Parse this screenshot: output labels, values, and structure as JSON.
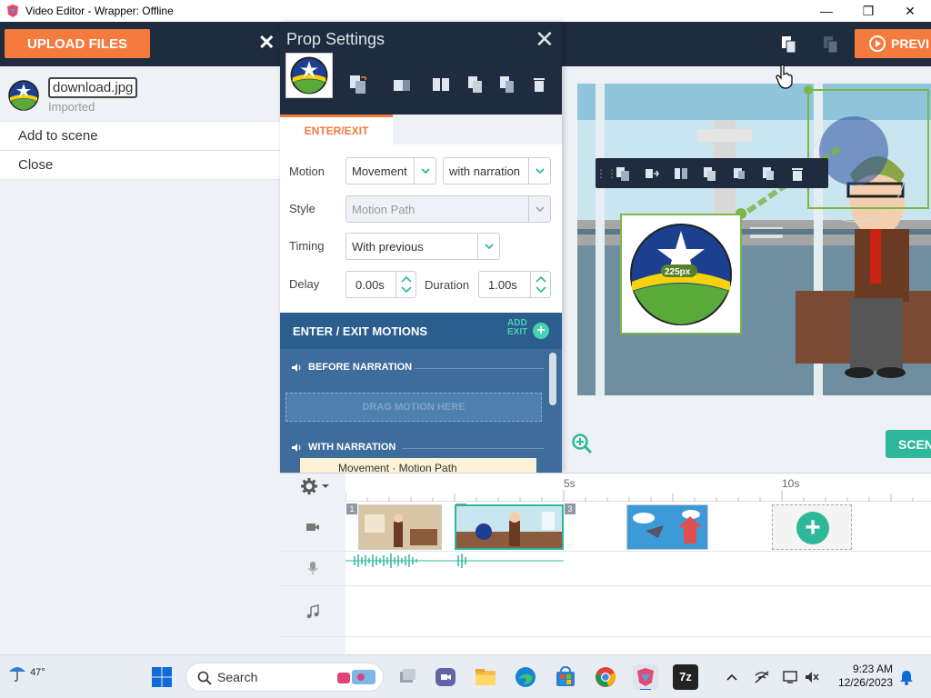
{
  "window": {
    "title": "Video Editor - Wrapper: Offline",
    "minimize": "—",
    "maximize": "❐",
    "close": "✕"
  },
  "header": {
    "upload_label": "UPLOAD FILES",
    "close_symbol": "✕",
    "preview_label": "PREVI"
  },
  "asset": {
    "name": "download.jpg",
    "status": "Imported"
  },
  "context_menu": [
    "Add to scene",
    "Close"
  ],
  "prop_settings": {
    "title": "Prop Settings",
    "close_symbol": "✕",
    "tab": "ENTER/EXIT",
    "motion_label": "Motion",
    "motion_value": "Movement",
    "narration_value": "with narration",
    "style_label": "Style",
    "style_value": "Motion Path",
    "timing_label": "Timing",
    "timing_value": "With previous",
    "delay_label": "Delay",
    "delay_value": "0.00s",
    "duration_label": "Duration",
    "duration_value": "1.00s",
    "motions_header": "ENTER / EXIT MOTIONS",
    "add_exit_line1": "ADD",
    "add_exit_line2": "EXIT",
    "before_narration": "BEFORE NARRATION",
    "drag_placeholder": "DRAG MOTION HERE",
    "with_narration": "WITH NARRATION",
    "motion_item": "Movement · Motion Path"
  },
  "stage": {
    "size_label": "225px",
    "scene_label": "SCENE"
  },
  "timeline": {
    "marker_5s": "5s",
    "marker_10s": "10s",
    "scene_numbers": [
      "1",
      "2",
      "3"
    ],
    "add_scene": "+"
  },
  "taskbar": {
    "temperature": "47°",
    "search_placeholder": "Search",
    "time": "9:23 AM",
    "date": "12/26/2023",
    "app_7z": "7z"
  },
  "colors": {
    "accent_orange": "#f47a3d",
    "header_dark": "#1f2b3e",
    "teal": "#2eb899",
    "panel_blue": "#2b5e8f"
  }
}
